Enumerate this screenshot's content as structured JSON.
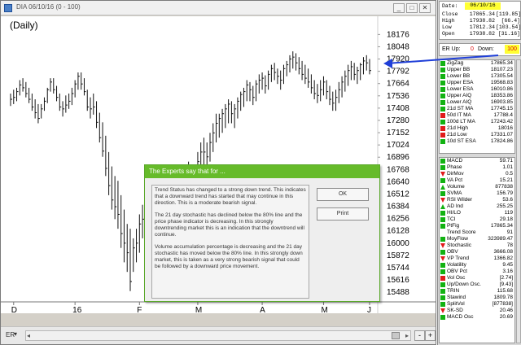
{
  "window": {
    "title": "DIA 06/10/16 (0 - 100)",
    "period": "(Daily)"
  },
  "controls": {
    "minimize": "_",
    "maximize": "□",
    "close": "✕",
    "er_label": "ER",
    "zoom_minus": "-",
    "zoom_plus": "+"
  },
  "chart_data": {
    "type": "ohlc",
    "y_ticks": [
      "18176",
      "18048",
      "17920",
      "17792",
      "17664",
      "17536",
      "17408",
      "17280",
      "17152",
      "17024",
      "16896",
      "16768",
      "16640",
      "16512",
      "16384",
      "16256",
      "16128",
      "16000",
      "15872",
      "15744",
      "15616",
      "15488"
    ],
    "ylim": [
      15430,
      18230
    ],
    "x_labels": [
      "D",
      "16",
      "F",
      "M",
      "A",
      "M",
      "J"
    ],
    "bars_approx": [
      [
        17560,
        17430,
        17500
      ],
      [
        17600,
        17450,
        17520
      ],
      [
        17620,
        17480,
        17580
      ],
      [
        17700,
        17540,
        17650
      ],
      [
        17720,
        17580,
        17620
      ],
      [
        17680,
        17520,
        17560
      ],
      [
        17620,
        17460,
        17500
      ],
      [
        17560,
        17380,
        17420
      ],
      [
        17500,
        17300,
        17360
      ],
      [
        17450,
        17250,
        17300
      ],
      [
        17450,
        17300,
        17400
      ],
      [
        17520,
        17380,
        17480
      ],
      [
        17620,
        17460,
        17600
      ],
      [
        17720,
        17580,
        17680
      ],
      [
        17720,
        17560,
        17600
      ],
      [
        17640,
        17480,
        17520
      ],
      [
        17560,
        17380,
        17420
      ],
      [
        17480,
        17320,
        17400
      ],
      [
        17540,
        17360,
        17440
      ],
      [
        17560,
        17400,
        17480
      ],
      [
        17620,
        17440,
        17560
      ],
      [
        17700,
        17520,
        17660
      ],
      [
        17780,
        17600,
        17740
      ],
      [
        17780,
        17600,
        17660
      ],
      [
        17720,
        17540,
        17580
      ],
      [
        17600,
        17380,
        17420
      ],
      [
        17520,
        17300,
        17400
      ],
      [
        17560,
        17340,
        17420
      ],
      [
        17480,
        17200,
        17260
      ],
      [
        17360,
        17050,
        17100
      ],
      [
        17260,
        16900,
        16960
      ],
      [
        17120,
        16700,
        16780
      ],
      [
        16950,
        16500,
        16600
      ],
      [
        16800,
        16350,
        16450
      ],
      [
        16700,
        16250,
        16380
      ],
      [
        16650,
        16150,
        16300
      ],
      [
        16500,
        15950,
        16100
      ],
      [
        16350,
        15800,
        16000
      ],
      [
        16200,
        15700,
        15900
      ],
      [
        16150,
        15500,
        15600
      ],
      [
        16050,
        15700,
        15950
      ],
      [
        16150,
        15800,
        16000
      ],
      [
        16300,
        15900,
        16200
      ],
      [
        16400,
        16050,
        16250
      ],
      [
        16400,
        16000,
        16150
      ],
      [
        16350,
        15950,
        16100
      ],
      [
        16300,
        15800,
        15950
      ],
      [
        16150,
        15700,
        15850
      ],
      [
        16100,
        15800,
        16000
      ],
      [
        16300,
        15950,
        16200
      ],
      [
        16450,
        16150,
        16350
      ],
      [
        16500,
        16200,
        16300
      ],
      [
        16450,
        16100,
        16150
      ],
      [
        16350,
        16000,
        16100
      ],
      [
        16300,
        15950,
        16050
      ],
      [
        16450,
        16100,
        16350
      ],
      [
        16650,
        16300,
        16550
      ],
      [
        16800,
        16450,
        16700
      ],
      [
        16850,
        16500,
        16600
      ],
      [
        16750,
        16400,
        16500
      ],
      [
        16800,
        16450,
        16700
      ],
      [
        16950,
        16600,
        16850
      ],
      [
        17050,
        16700,
        16950
      ],
      [
        17100,
        16800,
        16950
      ],
      [
        17050,
        16750,
        16900
      ],
      [
        17150,
        16850,
        17050
      ],
      [
        17250,
        16950,
        17150
      ],
      [
        17350,
        17050,
        17250
      ],
      [
        17350,
        17100,
        17300
      ],
      [
        17400,
        17150,
        17350
      ],
      [
        17450,
        17200,
        17400
      ],
      [
        17500,
        17250,
        17450
      ],
      [
        17480,
        17250,
        17350
      ],
      [
        17450,
        17200,
        17400
      ],
      [
        17520,
        17300,
        17480
      ],
      [
        17580,
        17380,
        17550
      ],
      [
        17620,
        17420,
        17580
      ],
      [
        17700,
        17480,
        17650
      ],
      [
        17680,
        17480,
        17600
      ],
      [
        17640,
        17440,
        17520
      ],
      [
        17700,
        17480,
        17660
      ],
      [
        17760,
        17560,
        17700
      ],
      [
        17780,
        17600,
        17720
      ],
      [
        17750,
        17560,
        17640
      ],
      [
        17800,
        17600,
        17760
      ],
      [
        17860,
        17680,
        17820
      ],
      [
        17880,
        17700,
        17780
      ],
      [
        17820,
        17660,
        17740
      ],
      [
        17800,
        17600,
        17700
      ],
      [
        17860,
        17660,
        17820
      ],
      [
        17900,
        17740,
        17860
      ],
      [
        17960,
        17780,
        17920
      ],
      [
        18000,
        17820,
        17940
      ],
      [
        17980,
        17800,
        17880
      ],
      [
        17940,
        17760,
        17820
      ],
      [
        17900,
        17700,
        17760
      ],
      [
        17860,
        17660,
        17720
      ],
      [
        17820,
        17620,
        17680
      ],
      [
        17760,
        17560,
        17620
      ],
      [
        17700,
        17500,
        17560
      ],
      [
        17660,
        17460,
        17540
      ],
      [
        17700,
        17480,
        17600
      ],
      [
        17740,
        17540,
        17680
      ],
      [
        17700,
        17500,
        17580
      ],
      [
        17640,
        17440,
        17500
      ],
      [
        17580,
        17380,
        17460
      ],
      [
        17600,
        17380,
        17520
      ],
      [
        17680,
        17460,
        17600
      ],
      [
        17740,
        17520,
        17680
      ],
      [
        17800,
        17580,
        17740
      ],
      [
        17860,
        17640,
        17800
      ],
      [
        17900,
        17700,
        17840
      ],
      [
        17880,
        17700,
        17760
      ],
      [
        17840,
        17660,
        17800
      ],
      [
        17880,
        17700,
        17860
      ],
      [
        17940,
        17760,
        17900
      ],
      [
        17960,
        17800,
        17880
      ],
      [
        17920,
        17760,
        17800
      ]
    ]
  },
  "dialog": {
    "title": "The Experts say that for ...",
    "paragraphs": [
      "Trend Status has changed to a strong down trend.  This indicates that a downward trend has started that may continue in this direction.  This is a moderate bearish signal.",
      "The 21 day stochastic has declined below the 80% line and the price phase indicator is decreasing. In this strongly downtrending market this is an indication that the downtrend will continue.",
      "Volume accumulation percentage is decreasing and the 21 day stochastic has moved below the 80% line. In this strongly down market, this is taken as a  very strong bearish signal that could be followed  by a downward price movement."
    ],
    "ok_label": "OK",
    "print_label": "Print"
  },
  "quote": {
    "date_label": "Date:",
    "date": "06/10/16",
    "rows": [
      {
        "label": "Close",
        "value": "17865.34",
        "change": "[119.85]"
      },
      {
        "label": "High",
        "value": "17938.82",
        "change": "[66.4]"
      },
      {
        "label": "Low",
        "value": "17812.34",
        "change": "[103.54]"
      },
      {
        "label": "Open",
        "value": "17938.82",
        "change": "[31.16]"
      }
    ]
  },
  "er": {
    "up_label": "ER Up:",
    "up": "0",
    "down_label": "Down:",
    "down": "100"
  },
  "colors": {
    "green": "#12b212",
    "red": "#e01b1b",
    "yellow": "#e6c800",
    "arrow": "#1f3fd8",
    "dialog_title": "#66bb2a"
  },
  "indicators_top": [
    {
      "name": "ZigZag",
      "value": "17865.34",
      "marker": "green"
    },
    {
      "name": "Upper BB",
      "value": "18107.23",
      "marker": "green"
    },
    {
      "name": "Lower BB",
      "value": "17305.54",
      "marker": "green"
    },
    {
      "name": "Upper ESA",
      "value": "19568.83",
      "marker": "green"
    },
    {
      "name": "Lower ESA",
      "value": "16010.86",
      "marker": "green"
    },
    {
      "name": "Upper AIQ",
      "value": "18353.86",
      "marker": "green"
    },
    {
      "name": "Lower AIQ",
      "value": "16903.85",
      "marker": "green"
    },
    {
      "name": "21d ST MA",
      "value": "17745.15",
      "marker": "green"
    },
    {
      "name": "50d IT MA",
      "value": "17788.4",
      "marker": "red"
    },
    {
      "name": "100d LT MA",
      "value": "17243.42",
      "marker": "green"
    },
    {
      "name": "21d High",
      "value": "18016",
      "marker": "red"
    },
    {
      "name": "21d Low",
      "value": "17331.07",
      "marker": "red"
    },
    {
      "name": "10d ST ESA",
      "value": "17824.86",
      "marker": "green"
    }
  ],
  "indicators_bottom": [
    {
      "name": "MACD",
      "value": "59.71",
      "marker": "green"
    },
    {
      "name": "Phase",
      "value": "1.01",
      "marker": "green"
    },
    {
      "name": "DirMov",
      "value": "0.5",
      "marker": "down-red"
    },
    {
      "name": "VA Pct",
      "value": "15.21",
      "marker": "green"
    },
    {
      "name": "Volume",
      "value": "877838",
      "marker": "up-green"
    },
    {
      "name": "SVMA",
      "value": "156.79",
      "marker": "green"
    },
    {
      "name": "RSI Wilder",
      "value": "53.6",
      "marker": "down-red"
    },
    {
      "name": "AD Ind",
      "value": "255.25",
      "marker": "up-green"
    },
    {
      "name": "HI/LO",
      "value": "119",
      "marker": "green"
    },
    {
      "name": "TCI",
      "value": "29.18",
      "marker": "green"
    },
    {
      "name": "PtFig",
      "value": "17865.34",
      "marker": "green"
    },
    {
      "name": "Trend Score",
      "value": "91",
      "marker": "none"
    },
    {
      "name": "MoyFlow",
      "value": "323989.47",
      "marker": "green"
    },
    {
      "name": "Stochastic",
      "value": "78",
      "marker": "down-red"
    },
    {
      "name": "OBV",
      "value": "3666.08",
      "marker": "green"
    },
    {
      "name": "VP Trend",
      "value": "1366.82",
      "marker": "down-red"
    },
    {
      "name": "Volatility",
      "value": "9.45",
      "marker": "green"
    },
    {
      "name": "OBV Pct",
      "value": "3.16",
      "marker": "green"
    },
    {
      "name": "Vol Osc",
      "value": "[2.74]",
      "marker": "red"
    },
    {
      "name": "Up/Down Osc.",
      "value": "[9.43]",
      "marker": "green"
    },
    {
      "name": "TRIN",
      "value": "115.68",
      "marker": "green"
    },
    {
      "name": "Stawind",
      "value": "1809.78",
      "marker": "green"
    },
    {
      "name": "SplitVol",
      "value": "[877838]",
      "marker": "green"
    },
    {
      "name": "SK-SD",
      "value": "20.46",
      "marker": "down-red"
    },
    {
      "name": "MACD Osc",
      "value": "20.69",
      "marker": "green"
    }
  ]
}
